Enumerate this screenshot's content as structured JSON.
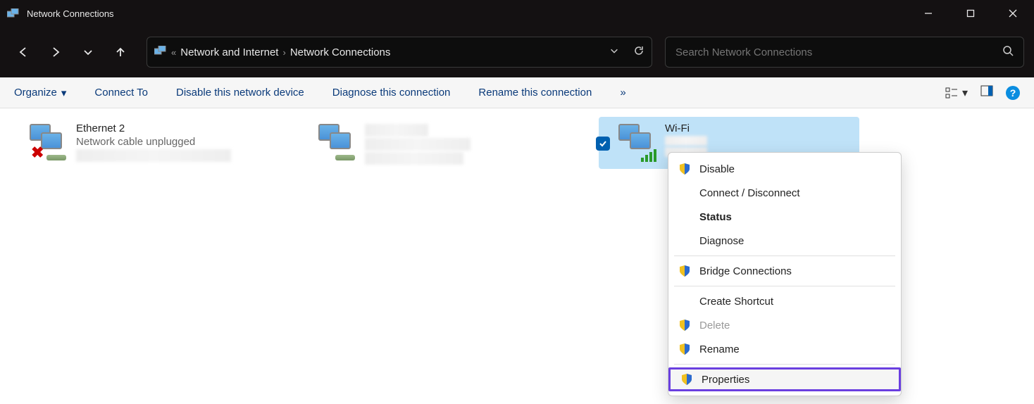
{
  "window": {
    "title": "Network Connections"
  },
  "breadcrumb": {
    "parent": "Network and Internet",
    "current": "Network Connections"
  },
  "search": {
    "placeholder": "Search Network Connections"
  },
  "commands": {
    "organize": "Organize",
    "connect_to": "Connect To",
    "disable": "Disable this network device",
    "diagnose": "Diagnose this connection",
    "rename": "Rename this connection",
    "more": "»"
  },
  "connections": [
    {
      "name": "Ethernet 2",
      "status": "Network cable unplugged",
      "type": "ethernet_unplugged",
      "selected": false
    },
    {
      "name": "",
      "status": "",
      "type": "ethernet",
      "selected": false
    },
    {
      "name": "Wi-Fi",
      "status": "",
      "type": "wifi",
      "selected": true
    }
  ],
  "context_menu": {
    "disable": "Disable",
    "connect": "Connect / Disconnect",
    "status": "Status",
    "diagnose": "Diagnose",
    "bridge": "Bridge Connections",
    "shortcut": "Create Shortcut",
    "delete": "Delete",
    "rename": "Rename",
    "properties": "Properties",
    "highlighted": "properties"
  }
}
